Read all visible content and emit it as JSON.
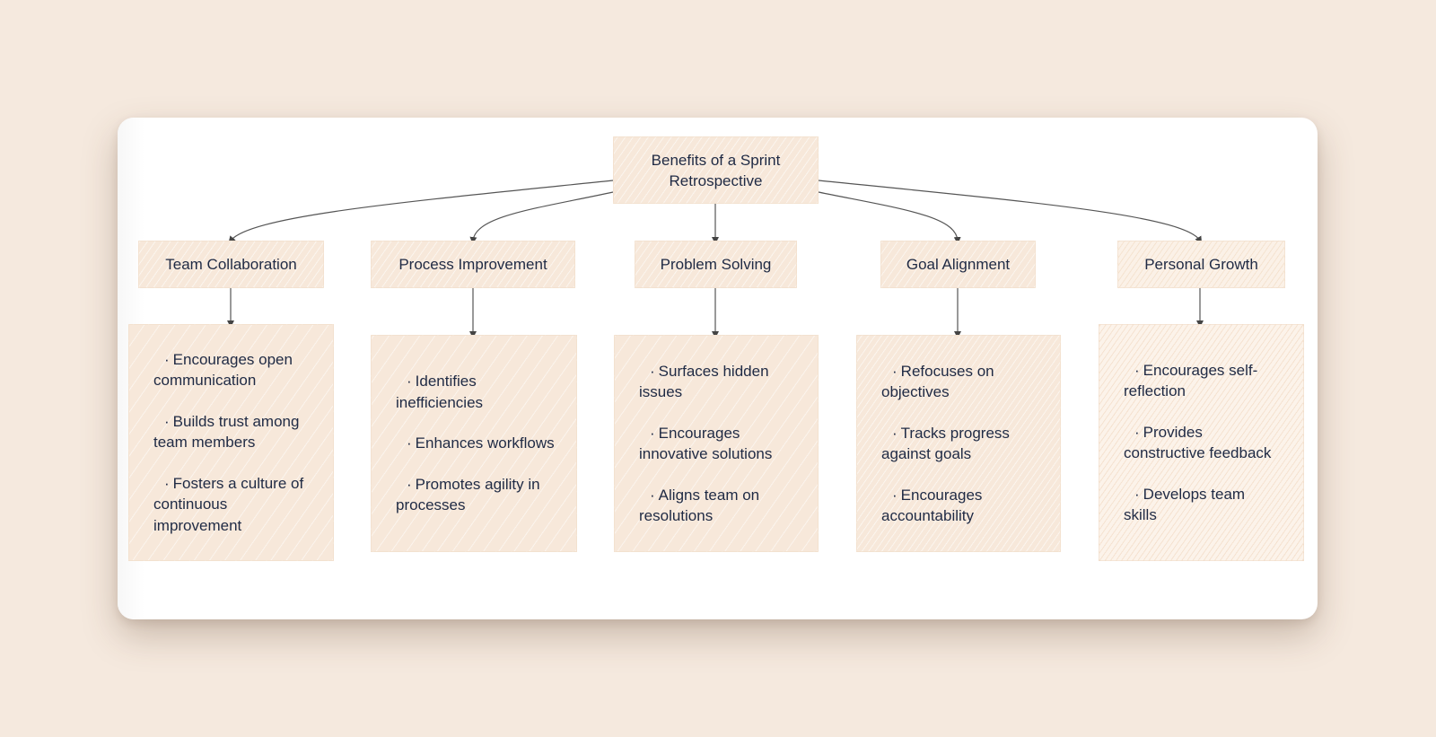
{
  "diagram": {
    "root": {
      "label": "Benefits of a Sprint Retrospective"
    },
    "branches": [
      {
        "label": "Team Collaboration",
        "items": [
          "Encourages open communication",
          "Builds trust among team members",
          "Fosters a culture of continuous improvement"
        ]
      },
      {
        "label": "Process Improvement",
        "items": [
          "Identifies inefficiencies",
          "Enhances workflows",
          "Promotes agility in processes"
        ]
      },
      {
        "label": "Problem Solving",
        "items": [
          "Surfaces hidden issues",
          "Encourages innovative solutions",
          "Aligns team on resolutions"
        ]
      },
      {
        "label": "Goal Alignment",
        "items": [
          "Refocuses on objectives",
          "Tracks progress against goals",
          "Encourages accountability"
        ]
      },
      {
        "label": "Personal Growth",
        "items": [
          "Encourages self-reflection",
          "Provides constructive feedback",
          "Develops team skills"
        ]
      }
    ],
    "bullet_glyph": "·"
  },
  "colors": {
    "background": "#f5e9de",
    "node_fill": "#f7e8da",
    "text": "#1f2a44",
    "edge": "#555555"
  }
}
